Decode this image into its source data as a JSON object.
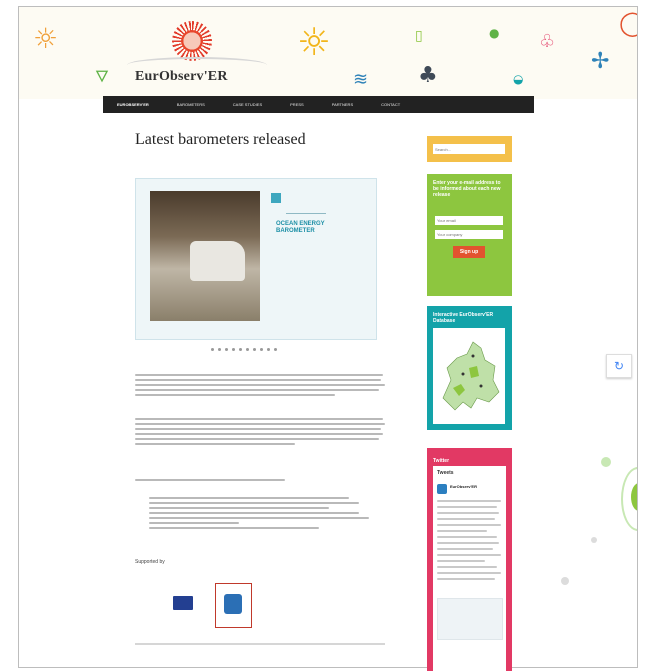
{
  "site": {
    "logo": "EurObserv'ER"
  },
  "nav": {
    "items": [
      {
        "label": "EurObserv'ER"
      },
      {
        "label": "Barometers"
      },
      {
        "label": "Case studies"
      },
      {
        "label": "Press"
      },
      {
        "label": "Partners"
      },
      {
        "label": "Contact"
      }
    ]
  },
  "page": {
    "title": "Latest barometers released"
  },
  "slider": {
    "label": "OCEAN ENERGY BAROMETER",
    "dots_count": 10
  },
  "supported_by": {
    "label": "Supported by"
  },
  "sidebar": {
    "search": {
      "placeholder": "Search..."
    },
    "newsletter": {
      "title": "Enter your e-mail address to be informed about each new release",
      "email_placeholder": "Your email",
      "name_placeholder": "Your company",
      "button_label": "Sign up"
    },
    "database": {
      "title": "Interactive EurObserv'ER Database"
    },
    "twitter": {
      "title": "Twitter",
      "widget_header": "Tweets",
      "account_name": "EurObserv'ER"
    }
  },
  "colors": {
    "nav_bg": "#222222",
    "search_box": "#f4c04a",
    "newsletter_box": "#8dc63f",
    "signup_button": "#e2532f",
    "database_box": "#13a3a9",
    "twitter_box": "#e23964",
    "accent_teal": "#1c8fa6"
  },
  "icons": [
    "sun-icon",
    "water-drop-icon",
    "wave-icon",
    "tree-icon",
    "wind-turbine-icon",
    "battery-icon",
    "refresh-icon",
    "eu-flag-icon"
  ]
}
